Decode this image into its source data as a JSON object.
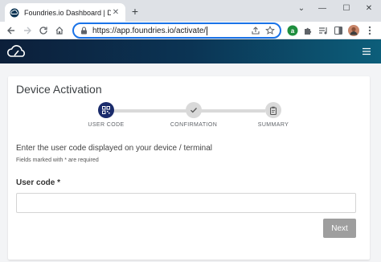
{
  "browser": {
    "tab_title": "Foundries.io Dashboard | Device",
    "new_tab_label": "+",
    "url_prefix": "https://",
    "url": "app.foundries.io/activate/"
  },
  "card": {
    "title": "Device Activation",
    "steps": [
      {
        "label": "USER CODE",
        "state": "active"
      },
      {
        "label": "CONFIRMATION",
        "state": "inactive"
      },
      {
        "label": "SUMMARY",
        "state": "inactive"
      }
    ],
    "instruction": "Enter the user code displayed on your device / terminal",
    "required_note": "Fields marked with * are required",
    "field_label": "User code *",
    "field_value": "",
    "next_label": "Next"
  },
  "colors": {
    "accent": "#1a73e8",
    "step_active": "#1a2b6b",
    "button_disabled": "#9e9e9e"
  }
}
